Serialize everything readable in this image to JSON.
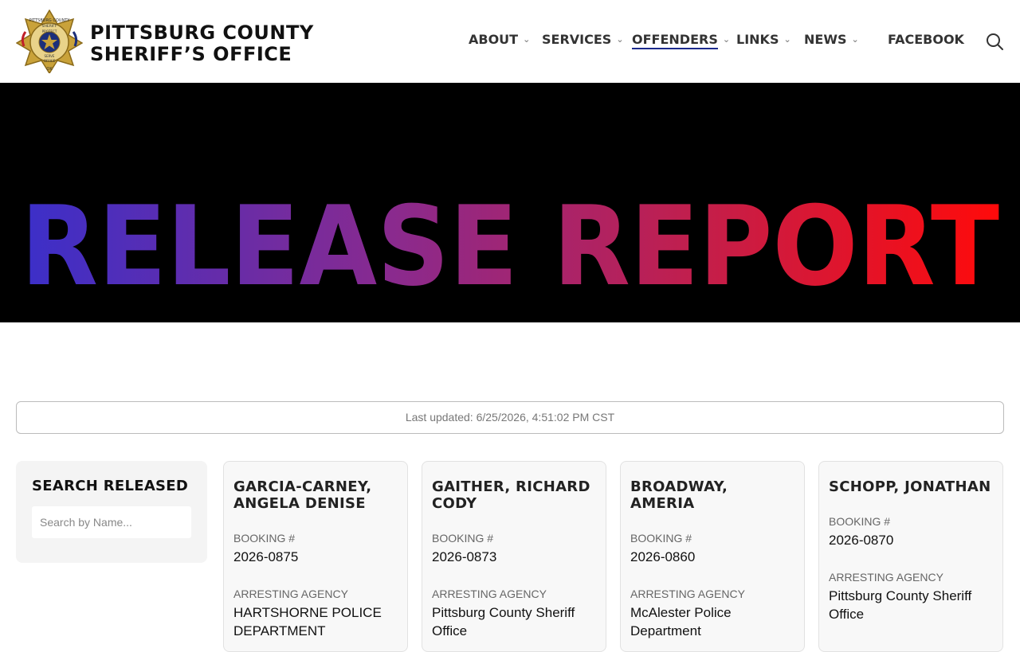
{
  "header": {
    "logo_line1": "PITTSBURG COUNTY",
    "logo_line2": "SHERIFF’S OFFICE",
    "badge_text": [
      "PITTSBURG COUNTY",
      "SHERIFF",
      "PROTECT",
      "SERVE",
      "OFFICE",
      "OK"
    ],
    "nav": [
      {
        "label": "ABOUT",
        "dropdown": true,
        "active": false
      },
      {
        "label": "SERVICES",
        "dropdown": true,
        "active": false
      },
      {
        "label": "OFFENDERS",
        "dropdown": true,
        "active": true
      },
      {
        "label": "LINKS",
        "dropdown": true,
        "active": false
      },
      {
        "label": "NEWS",
        "dropdown": true,
        "active": false
      },
      {
        "label": "FACEBOOK",
        "dropdown": false,
        "active": false
      }
    ],
    "search_icon": "search-icon"
  },
  "hero": {
    "title": "RELEASE REPORT",
    "gradient": [
      "#3b2fc9",
      "#8a2a8e",
      "#c41e4a",
      "#ff0a0a"
    ],
    "background": "#000000"
  },
  "last_updated": "Last updated: 6/25/2026, 4:51:02 PM CST",
  "sidebar": {
    "title": "SEARCH RELEASED",
    "search_placeholder": "Search by Name..."
  },
  "labels": {
    "booking": "BOOKING #",
    "agency": "ARRESTING AGENCY"
  },
  "records": [
    {
      "name": "GARCIA-CARNEY, ANGELA DENISE",
      "booking": "2026-0875",
      "agency": "HARTSHORNE POLICE DEPARTMENT"
    },
    {
      "name": "GAITHER, RICHARD CODY",
      "booking": "2026-0873",
      "agency": "Pittsburg County Sheriff Office"
    },
    {
      "name": "BROADWAY, AMERIA",
      "booking": "2026-0860",
      "agency": "McAlester Police Department"
    },
    {
      "name": "SCHOPP, JONATHAN",
      "booking": "2026-0870",
      "agency": "Pittsburg County Sheriff Office"
    }
  ]
}
